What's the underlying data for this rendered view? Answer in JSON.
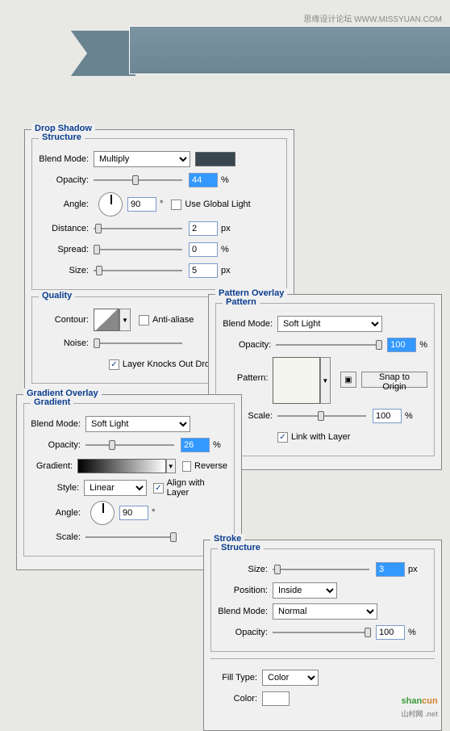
{
  "watermark": "思缘设计论坛  WWW.MISSYUAN.COM",
  "dropShadow": {
    "title": "Drop Shadow",
    "structure": "Structure",
    "blendModeLabel": "Blend Mode:",
    "blendMode": "Multiply",
    "opacityLabel": "Opacity:",
    "opacity": "44",
    "opacityUnit": "%",
    "angleLabel": "Angle:",
    "angle": "90",
    "angleUnit": "°",
    "useGlobalLabel": "Use Global Light",
    "distanceLabel": "Distance:",
    "distance": "2",
    "spreadLabel": "Spread:",
    "spread": "0",
    "sizeLabel": "Size:",
    "size": "5",
    "pxUnit": "px",
    "pctUnit": "%",
    "quality": "Quality",
    "contourLabel": "Contour:",
    "antiAliasLabel": "Anti-aliase",
    "noiseLabel": "Noise:",
    "layerKnocksLabel": "Layer Knocks Out Dro"
  },
  "patternOverlay": {
    "title": "Pattern Overlay",
    "groupTitle": "Pattern",
    "blendModeLabel": "Blend Mode:",
    "blendMode": "Soft Light",
    "opacityLabel": "Opacity:",
    "opacity": "100",
    "opacityUnit": "%",
    "patternLabel": "Pattern:",
    "snapLabel": "Snap to Origin",
    "scaleLabel": "Scale:",
    "scale": "100",
    "scaleUnit": "%",
    "linkLabel": "Link with Layer"
  },
  "gradientOverlay": {
    "title": "Gradient Overlay",
    "groupTitle": "Gradient",
    "blendModeLabel": "Blend Mode:",
    "blendMode": "Soft Light",
    "opacityLabel": "Opacity:",
    "opacity": "26",
    "opacityUnit": "%",
    "gradientLabel": "Gradient:",
    "reverseLabel": "Reverse",
    "styleLabel": "Style:",
    "style": "Linear",
    "alignLabel": "Align with Layer",
    "angleLabel": "Angle:",
    "angle": "90",
    "angleUnit": "°",
    "scaleLabel": "Scale:"
  },
  "stroke": {
    "title": "Stroke",
    "structure": "Structure",
    "sizeLabel": "Size:",
    "size": "3",
    "sizeUnit": "px",
    "positionLabel": "Position:",
    "position": "Inside",
    "blendModeLabel": "Blend Mode:",
    "blendMode": "Normal",
    "opacityLabel": "Opacity:",
    "opacity": "100",
    "opacityUnit": "%",
    "fillTypeLabel": "Fill Type:",
    "fillType": "Color",
    "colorLabel": "Color:",
    "colorValue": "#ffffff"
  },
  "logo": {
    "text1": "shan",
    "text2": "cun",
    "sub": "山村网 .net"
  }
}
